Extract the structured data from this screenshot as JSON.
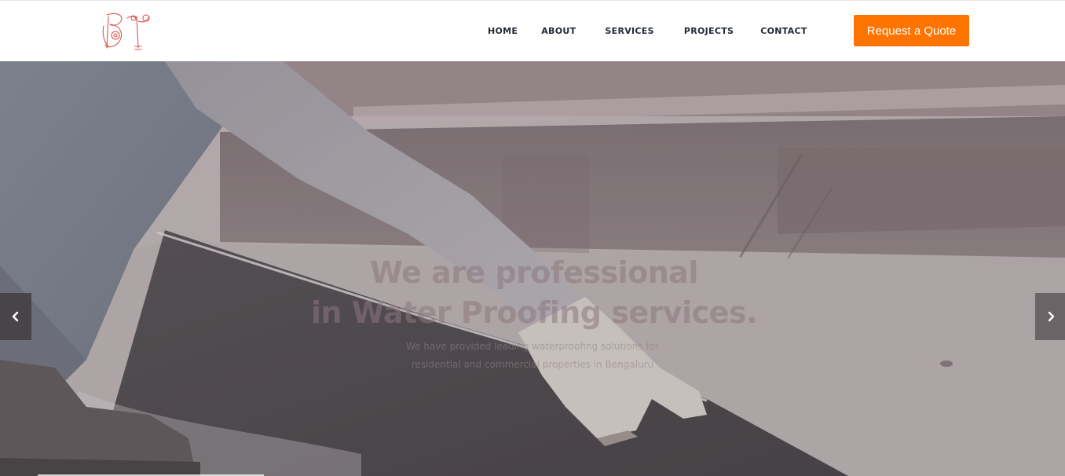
{
  "header": {
    "logo_name": "logo",
    "nav": [
      {
        "label": "HOME"
      },
      {
        "label": "ABOUT"
      },
      {
        "label": "SERVICES"
      },
      {
        "label": "PROJECTS"
      },
      {
        "label": "CONTACT"
      }
    ],
    "quote_button": "Request a Quote",
    "accent_color": "#ff7400"
  },
  "hero": {
    "title_line1": "We are professional",
    "title_line2": "in Water Proofing services.",
    "subtitle_line1": "We have provided leading waterproofing solutions for",
    "subtitle_line2": "residential and commercial properties in Bengaluru",
    "prev_icon": "chevron-left-icon",
    "next_icon": "chevron-right-icon"
  }
}
